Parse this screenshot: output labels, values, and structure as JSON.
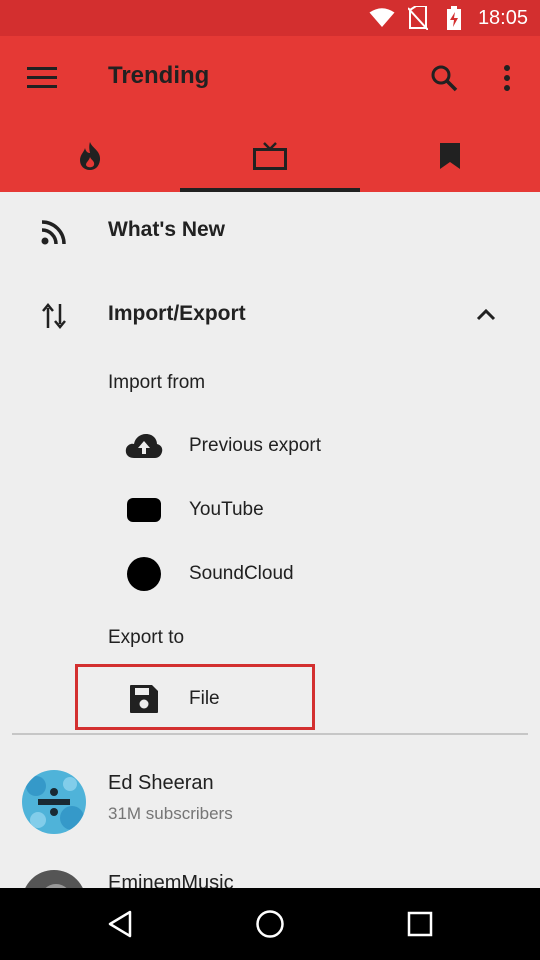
{
  "status_bar": {
    "time": "18:05",
    "icons": [
      "wifi-icon",
      "no-sim-icon",
      "battery-charging-icon"
    ]
  },
  "app_bar": {
    "title": "Trending",
    "icons": [
      "menu-icon",
      "search-icon",
      "more-vert-icon"
    ],
    "tabs": [
      {
        "icon": "fire-icon",
        "active": false
      },
      {
        "icon": "tv-icon",
        "active": true
      },
      {
        "icon": "bookmark-icon",
        "active": false
      }
    ]
  },
  "drawer": {
    "whats_new": {
      "label": "What's New",
      "icon": "rss-icon"
    },
    "import_export": {
      "label": "Import/Export",
      "icon": "swap-vert-icon",
      "expanded": true
    },
    "import_from_label": "Import from",
    "import_items": [
      {
        "label": "Previous export",
        "icon": "cloud-upload-icon"
      },
      {
        "label": "YouTube",
        "icon": "youtube-icon"
      },
      {
        "label": "SoundCloud",
        "icon": "soundcloud-icon"
      }
    ],
    "export_to_label": "Export to",
    "export_items": [
      {
        "label": "File",
        "icon": "save-icon"
      }
    ]
  },
  "channels": [
    {
      "name": "Ed Sheeran",
      "subscribers": "31M subscribers"
    },
    {
      "name": "EminemMusic",
      "subscribers": ""
    }
  ],
  "colors": {
    "status_bar": "#d32f2f",
    "app_bar": "#e53935",
    "background": "#eeeeee",
    "highlight_border": "#d32f2f"
  }
}
